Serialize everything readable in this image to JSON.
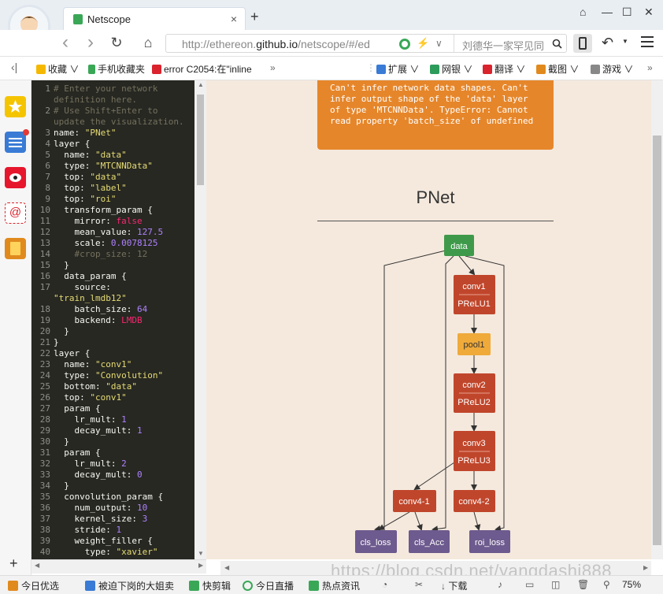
{
  "tab": {
    "title": "Netscope",
    "close": "×",
    "new_tab": "+"
  },
  "window": {
    "skin": "⌂",
    "minimize": "—",
    "maximize": "☐",
    "close": "✕"
  },
  "nav": {
    "back": "‹",
    "forward": "›",
    "reload": "↻",
    "home": "⌂"
  },
  "address": {
    "url_prefix": "http://ethereon.",
    "url_domain": "github.io",
    "url_suffix": "/netscope/#/ed",
    "search_text": "刘德华一家罕见同",
    "dropdown": "∨"
  },
  "bookmarks": [
    {
      "label": "收藏",
      "icon": "star-icon",
      "color": "#f5b800"
    },
    {
      "label": "手机收藏夹",
      "icon": "phone-icon",
      "color": "#3aa757"
    },
    {
      "label": "error C2054:在\"inline",
      "icon": "c-icon",
      "color": "#d9232d"
    }
  ],
  "toolbar_right": [
    {
      "label": "扩展",
      "icon": "extension-icon",
      "color": "#3a7bd5"
    },
    {
      "label": "网银",
      "icon": "bank-icon",
      "color": "#2d9c5b"
    },
    {
      "label": "翻译",
      "icon": "translate-icon",
      "color": "#d9232d"
    },
    {
      "label": "截图",
      "icon": "screenshot-icon",
      "color": "#e08a1e"
    },
    {
      "label": "游戏",
      "icon": "game-icon",
      "color": "#666666"
    }
  ],
  "code_lines": [
    "# Enter your network",
    "definition here.",
    "# Use Shift+Enter to",
    "update the visualization.",
    "name: \"PNet\"",
    "layer {",
    "  name: \"data\"",
    "  type: \"MTCNNData\"",
    "  top: \"data\"",
    "  top: \"label\"",
    "  top: \"roi\"",
    "  transform_param {",
    "    mirror: false",
    "    mean_value: 127.5",
    "    scale: 0.0078125",
    "    #crop_size: 12",
    "  }",
    "  data_param {",
    "    source:",
    "\"train_lmdb12\"",
    "    batch_size: 64",
    "    backend: LMDB",
    "  }",
    "}",
    "layer {",
    "  name: \"conv1\"",
    "  type: \"Convolution\"",
    "  bottom: \"data\"",
    "  top: \"conv1\"",
    "  param {",
    "    lr_mult: 1",
    "    decay_mult: 1",
    "  }",
    "  param {",
    "    lr_mult: 2",
    "    decay_mult: 0",
    "  }",
    "  convolution_param {",
    "    num_output: 10",
    "    kernel_size: 3",
    "    stride: 1",
    "    weight_filler {",
    "      type: \"xavier\""
  ],
  "line_numbers": [
    "1",
    "",
    "2",
    "",
    "3",
    "4",
    "5",
    "6",
    "7",
    "8",
    "9",
    "10",
    "11",
    "12",
    "13",
    "14",
    "15",
    "16",
    "17",
    "",
    "18",
    "19",
    "20",
    "21",
    "22",
    "23",
    "24",
    "25",
    "26",
    "27",
    "28",
    "29",
    "30",
    "31",
    "32",
    "33",
    "34",
    "35",
    "36",
    "37",
    "38",
    "39",
    "40"
  ],
  "error_message": "Can't infer network data shapes. Can't infer output shape of the 'data' layer of type 'MTCNNData'. TypeError: Cannot read property 'batch_size' of undefined",
  "network": {
    "title": "PNet",
    "nodes": [
      {
        "id": "data",
        "label": "data",
        "color": "#3e9a4a"
      },
      {
        "id": "conv1",
        "label": "conv1",
        "sub": "PReLU1",
        "color": "#c0462b"
      },
      {
        "id": "pool1",
        "label": "pool1",
        "color": "#efaa3a"
      },
      {
        "id": "conv2",
        "label": "conv2",
        "sub": "PReLU2",
        "color": "#c0462b"
      },
      {
        "id": "conv3",
        "label": "conv3",
        "sub": "PReLU3",
        "color": "#c0462b"
      },
      {
        "id": "conv4-1",
        "label": "conv4-1",
        "color": "#c0462b"
      },
      {
        "id": "conv4-2",
        "label": "conv4-2",
        "color": "#c0462b"
      },
      {
        "id": "cls_loss",
        "label": "cls_loss",
        "color": "#6d5a8e"
      },
      {
        "id": "cls_Acc",
        "label": "cls_Acc",
        "color": "#6d5a8e"
      },
      {
        "id": "roi_loss",
        "label": "roi_loss",
        "color": "#6d5a8e"
      }
    ]
  },
  "status_bar": [
    {
      "label": "今日优选",
      "icon": "gift-icon"
    },
    {
      "label": "被迫下岗的大姐卖",
      "icon": "news-icon"
    },
    {
      "label": "快剪辑",
      "icon": "video-icon"
    },
    {
      "label": "今日直播",
      "icon": "live-icon"
    },
    {
      "label": "热点资讯",
      "icon": "hot-icon"
    },
    {
      "label": "下载",
      "icon": "download-icon"
    }
  ],
  "zoom": "75%",
  "watermark": "https://blog.csdn.net/yangdashi888"
}
